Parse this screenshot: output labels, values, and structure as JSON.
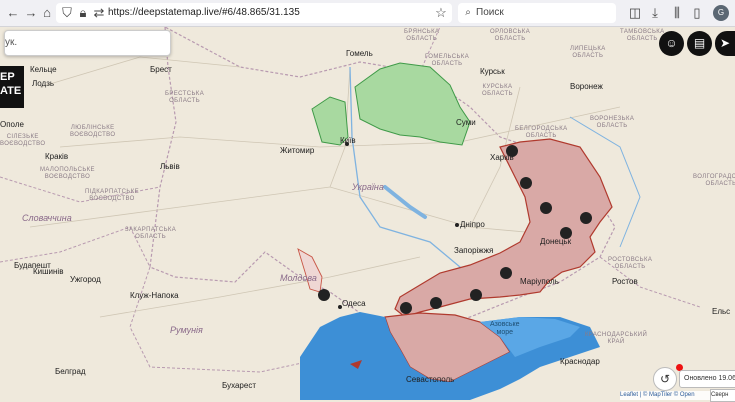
{
  "browser": {
    "url": "https://deepstatemap.live/#6/48.865/31.135",
    "search_placeholder": "Поиск",
    "profile_initial": "G"
  },
  "map_ui": {
    "search_value": "ук.",
    "logo_text": "EP\nATE",
    "updated_label": "Оновлено 19.06",
    "attribution": "Leaflet | © MapTiler © Open",
    "collapse_label": "Сверн"
  },
  "countries": {
    "ukraine": "Україна",
    "slovakia": "Словаччина",
    "moldova": "Молдова",
    "romania": "Румунія"
  },
  "cities": [
    {
      "name": "Брест"
    },
    {
      "name": "Гомель"
    },
    {
      "name": "Житомир"
    },
    {
      "name": "Львів"
    },
    {
      "name": "Краків"
    },
    {
      "name": "Лодзь"
    },
    {
      "name": "Кельце"
    },
    {
      "name": "Ополе"
    },
    {
      "name": "Дніпро"
    },
    {
      "name": "Запоріжжя"
    },
    {
      "name": "Одеса"
    },
    {
      "name": "Маріуполь"
    },
    {
      "name": "Севастополь"
    },
    {
      "name": "Краснодар"
    },
    {
      "name": "Воронеж"
    },
    {
      "name": "Суми"
    },
    {
      "name": "Харків"
    },
    {
      "name": "Бухарест"
    },
    {
      "name": "Будапешт"
    },
    {
      "name": "Клуж-Напока"
    },
    {
      "name": "Белград"
    },
    {
      "name": "Кишинів"
    },
    {
      "name": "Ростов"
    },
    {
      "name": "Донецьк"
    },
    {
      "name": "Київ"
    },
    {
      "name": "Ужгород"
    },
    {
      "name": "Курськ"
    },
    {
      "name": "Ельс"
    }
  ],
  "regions": [
    {
      "name": "БРЯНСЬКА\nОБЛАСТЬ"
    },
    {
      "name": "ОРЛОВСЬКА\nОБЛАСТЬ"
    },
    {
      "name": "ТАМБОВСЬКА\nОБЛАСТЬ"
    },
    {
      "name": "КУРСЬКА\nОБЛАСТЬ"
    },
    {
      "name": "ЛИПЕЦЬКА\nОБЛАСТЬ"
    },
    {
      "name": "БЕЛГОРОДСЬКА\nОБЛАСТЬ"
    },
    {
      "name": "ВОРОНЕЗЬКА\nОБЛАСТЬ"
    },
    {
      "name": "ВОЛГОГРАДСЬКА\nОБЛАСТЬ"
    },
    {
      "name": "РОСТОВСЬКА\nОБЛАСТЬ"
    },
    {
      "name": "КРАСНОДАРСЬКИЙ\nКРАЙ"
    },
    {
      "name": "БРЕСТСЬКА\nОБЛАСТЬ"
    },
    {
      "name": "ГОМЕЛЬСЬКА\nОБЛАСТЬ"
    },
    {
      "name": "ЗАКАРПАТСЬКА\nОБЛАСТЬ"
    },
    {
      "name": "ЛЮБЛІНСЬКЕ\nВОЄВОДСТВО"
    },
    {
      "name": "МАЛОПОЛЬСЬКЕ\nВОЄВОДСТВО"
    },
    {
      "name": "СІЛЕЗЬКЕ\nВОЄВОДСТВО"
    },
    {
      "name": "ПІДКАРПАТСЬКЕ\nВОЄВОДСТВО"
    }
  ],
  "seas": {
    "azov": "Азовське\nморе"
  },
  "colors": {
    "land": "#efe9dc",
    "occupied": "#d9a9a6",
    "occupied_border": "#b03a2e",
    "liberated": "#a8d9a0",
    "liberated_border": "#3f9a48",
    "sea": "#3d8fd6"
  }
}
